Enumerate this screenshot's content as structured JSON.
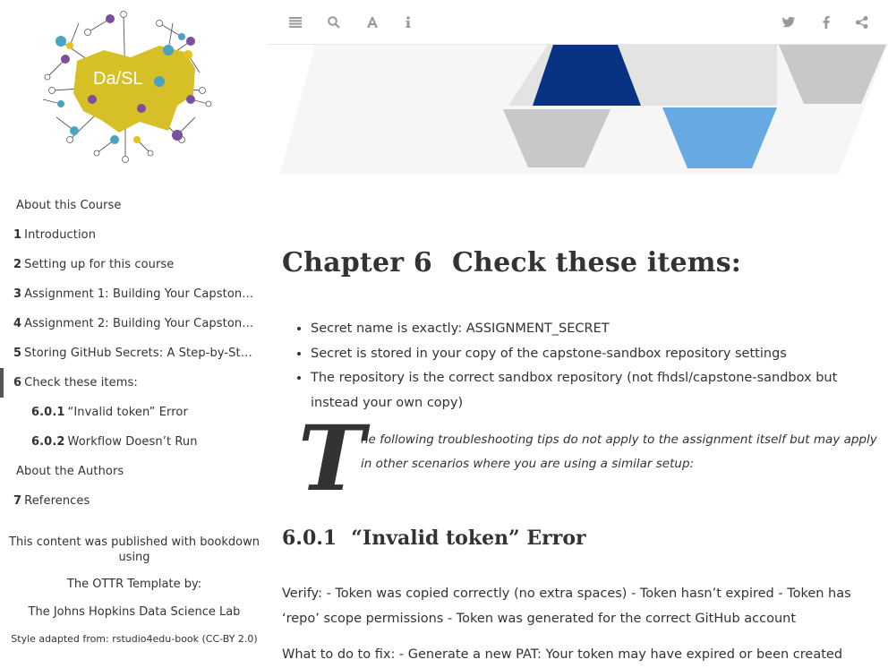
{
  "sidebar": {
    "logo_text": "Da/SL",
    "toc": [
      {
        "num": "",
        "label": "About this Course",
        "level": 1,
        "active": false
      },
      {
        "num": "1",
        "label": "Introduction",
        "level": 1,
        "active": false
      },
      {
        "num": "2",
        "label": "Setting up for this course",
        "level": 1,
        "active": false
      },
      {
        "num": "3",
        "label": "Assignment 1: Building Your Capstone …",
        "level": 1,
        "active": false
      },
      {
        "num": "4",
        "label": "Assignment 2: Building Your Capstone …",
        "level": 1,
        "active": false
      },
      {
        "num": "5",
        "label": "Storing GitHub Secrets: A Step-by-Step …",
        "level": 1,
        "active": false
      },
      {
        "num": "6",
        "label": "Check these items:",
        "level": 1,
        "active": true
      },
      {
        "num": "6.0.1",
        "label": "“Invalid token” Error",
        "level": 2,
        "active": false
      },
      {
        "num": "6.0.2",
        "label": "Workflow Doesn’t Run",
        "level": 2,
        "active": false
      },
      {
        "num": "",
        "label": "About the Authors",
        "level": 1,
        "active": false
      },
      {
        "num": "7",
        "label": "References",
        "level": 1,
        "active": false
      }
    ],
    "credits": {
      "published": "This content was published with bookdown using",
      "template": "The OTTR Template by:",
      "lab": "The Johns Hopkins Data Science Lab",
      "style": "Style adapted from: rstudio4edu-book (CC-BY 2.0)"
    }
  },
  "toolbar": {
    "left_icons": [
      "menu-icon",
      "search-icon",
      "font-icon",
      "info-icon"
    ],
    "right_icons": [
      "twitter-icon",
      "facebook-icon",
      "share-icon"
    ]
  },
  "colors": {
    "dark_blue": "#0a3283",
    "light_blue": "#67a9e2",
    "gray": "#c8c8c8",
    "light_gray": "#e3e3e3",
    "logo_yellow": "#d6bf27"
  },
  "main": {
    "chapter_num": "Chapter 6",
    "chapter_title": "Check these items:",
    "items": [
      "Secret name is exactly: ASSIGNMENT_SECRET",
      "Secret is stored in your copy of the capstone-sandbox repository settings",
      "The repository is the correct sandbox repository (not fhdsl/capstone-sandbox but instead your own copy)"
    ],
    "dropcap": "T",
    "tip_text": "he following troubleshooting tips do not apply to the assignment itself but may apply in other scenarios where you are using a similar setup:",
    "section_num": "6.0.1",
    "section_title": "“Invalid token” Error",
    "verify_text": "Verify: - Token was copied correctly (no extra spaces) - Token hasn’t expired - Token has ‘repo’ scope permissions - Token was generated for the correct GitHub account",
    "fix_text": "What to do to fix: - Generate a new PAT: Your token may have expired or been created"
  }
}
